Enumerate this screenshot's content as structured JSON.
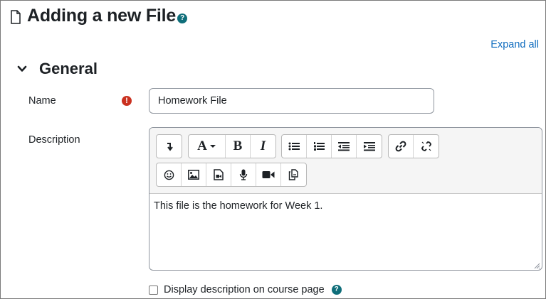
{
  "page": {
    "title": "Adding a new File",
    "help_glyph": "?",
    "expand_all": "Expand all"
  },
  "section": {
    "title": "General"
  },
  "form": {
    "name_label": "Name",
    "required_glyph": "!",
    "name_value": "Homework File",
    "description_label": "Description",
    "description_text": "This file is the homework for Week 1.",
    "display_description_label": "Display description on course page",
    "display_description_checked": false
  },
  "toolbar": {
    "font_glyph": "A",
    "bold_glyph": "B",
    "italic_glyph": "I",
    "icons": [
      "collapse-toolbar-icon",
      "font-style-icon",
      "bold-icon",
      "italic-icon",
      "unordered-list-icon",
      "ordered-list-icon",
      "outdent-icon",
      "indent-icon",
      "link-icon",
      "unlink-icon",
      "emoji-icon",
      "image-icon",
      "media-icon",
      "record-audio-icon",
      "record-video-icon",
      "manage-files-icon"
    ]
  },
  "colors": {
    "link": "#0f6cbf",
    "required": "#ca3120",
    "help": "#0f6e7a",
    "text": "#1d2125"
  }
}
